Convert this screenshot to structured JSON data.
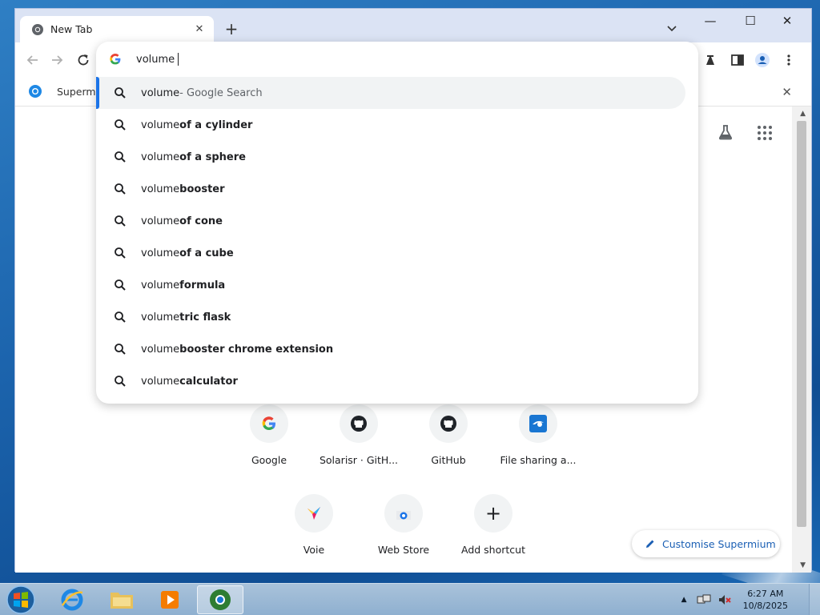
{
  "browser": {
    "tab_title": "New Tab",
    "bookmark_label": "Supermi",
    "window_controls": {
      "minimize": "—",
      "maximize": "☐",
      "close": "✕"
    }
  },
  "omnibox": {
    "query": "volume",
    "suggestions": [
      {
        "prefix": "volume",
        "suffix": "",
        "extra": " - Google Search",
        "selected": true
      },
      {
        "prefix": "volume ",
        "suffix": "of a cylinder"
      },
      {
        "prefix": "volume ",
        "suffix": "of a sphere"
      },
      {
        "prefix": "volume ",
        "suffix": "booster"
      },
      {
        "prefix": "volume ",
        "suffix": "of cone"
      },
      {
        "prefix": "volume ",
        "suffix": "of a cube"
      },
      {
        "prefix": "volume ",
        "suffix": "formula"
      },
      {
        "prefix": "volume",
        "suffix": "tric flask"
      },
      {
        "prefix": "volume ",
        "suffix": "booster chrome extension"
      },
      {
        "prefix": "volume ",
        "suffix": "calculator"
      }
    ]
  },
  "shortcuts": [
    {
      "label": "Google",
      "icon": "google-icon"
    },
    {
      "label": "Solarisr · GitH...",
      "icon": "github-icon"
    },
    {
      "label": "GitHub",
      "icon": "github-icon"
    },
    {
      "label": "File sharing a...",
      "icon": "file-sharing-icon"
    },
    {
      "label": "Voie",
      "icon": "bird-icon"
    },
    {
      "label": "Web Store",
      "icon": "webstore-icon"
    },
    {
      "label": "Add shortcut",
      "icon": "plus-icon"
    }
  ],
  "customise_label": "Customise Supermium",
  "taskbar": {
    "time": "6:27 AM",
    "date": "10/8/2025"
  },
  "colors": {
    "accent": "#1a73e8",
    "link": "#1a5fb4"
  }
}
